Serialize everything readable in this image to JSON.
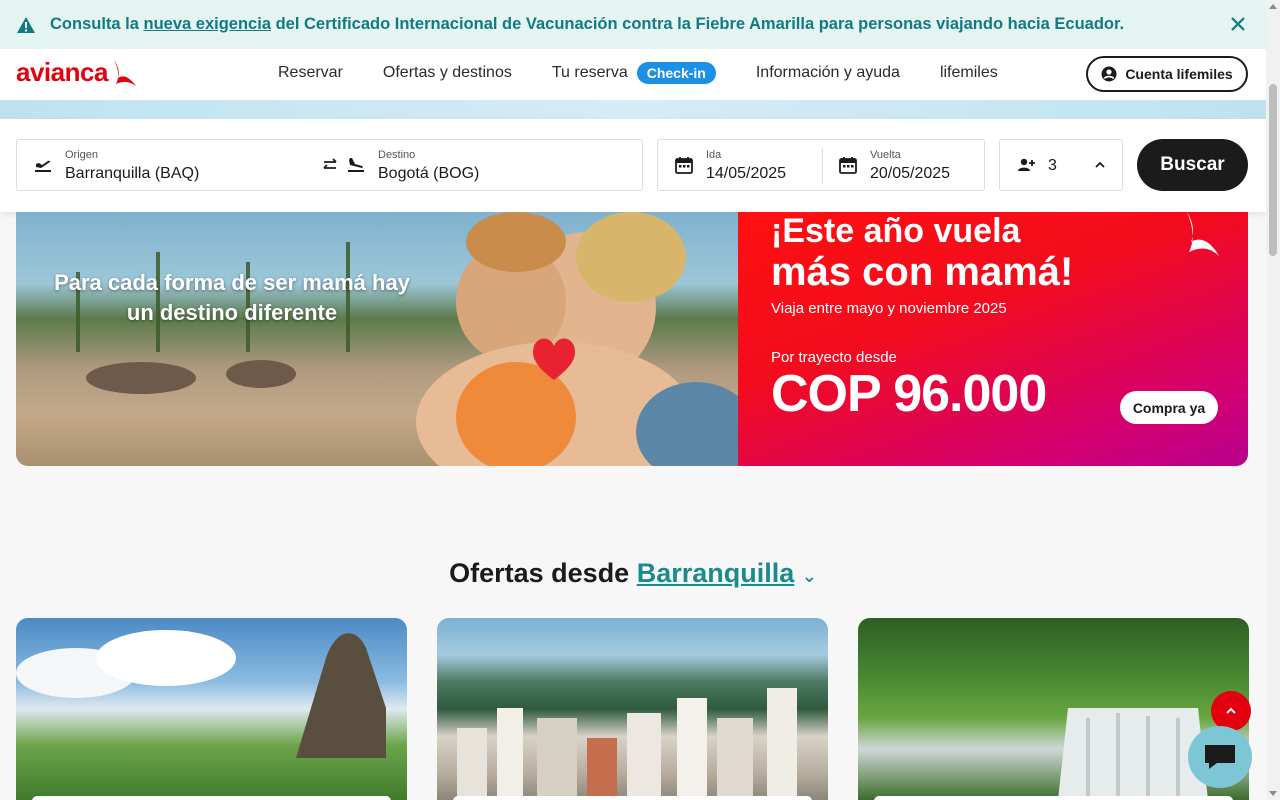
{
  "alert": {
    "prefix": "Consulta la ",
    "link": "nueva exigencia",
    "suffix": " del Certificado Internacional de Vacunación contra la Fiebre Amarilla para personas viajando hacia Ecuador.",
    "close_icon": "close-icon"
  },
  "header": {
    "logo": "avianca",
    "nav": [
      "Reservar",
      "Ofertas y destinos",
      "Tu reserva",
      "Información y ayuda",
      "lifemiles"
    ],
    "checkin": "Check-in",
    "account": "Cuenta lifemiles"
  },
  "search": {
    "origin_label": "Origen",
    "origin_value": "Barranquilla  (BAQ)",
    "dest_label": "Destino",
    "dest_value": "Bogotá  (BOG)",
    "depart_label": "Ida",
    "depart_value": "14/05/2025",
    "return_label": "Vuelta",
    "return_value": "20/05/2025",
    "passengers": "3",
    "button": "Buscar"
  },
  "hero": {
    "photo_text": "Para cada forma de ser mamá hay un destino diferente",
    "title_line1": "¡Este año vuela",
    "title_line2": "más con mamá!",
    "subtitle": "Viaja entre mayo y noviembre 2025",
    "desde": "Por trayecto desde",
    "price": "COP 96.000",
    "cta": "Compra ya"
  },
  "offers": {
    "title": "Ofertas desde",
    "city": "Barranquilla",
    "chevron": "⌄"
  },
  "colors": {
    "brand_red": "#e3000f",
    "teal": "#127a82",
    "checkin_blue": "#1c90e6"
  }
}
